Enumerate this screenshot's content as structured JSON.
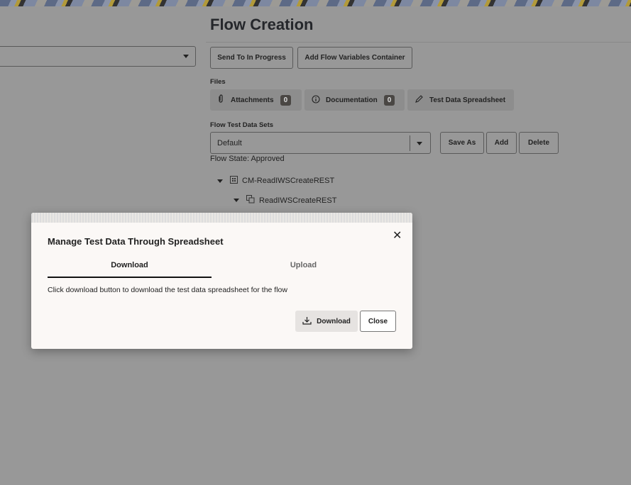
{
  "header": {
    "title": "Flow Creation"
  },
  "toolbar": {
    "send_label": "Send To In Progress",
    "add_container_label": "Add Flow Variables Container"
  },
  "files": {
    "label": "Files",
    "attachments": {
      "label": "Attachments",
      "count": "0"
    },
    "documentation": {
      "label": "Documentation",
      "count": "0"
    },
    "spreadsheet": {
      "label": "Test Data Spreadsheet"
    }
  },
  "datasets": {
    "label": "Flow Test Data Sets",
    "selected": "Default",
    "save_as": "Save As",
    "add": "Add",
    "delete": "Delete",
    "state": "Flow State: Approved"
  },
  "tree": [
    {
      "label": "CM-ReadIWSCreateREST",
      "icon": "grid-icon"
    },
    {
      "label": "ReadIWSCreateREST",
      "icon": "copy-icon"
    }
  ],
  "dialog": {
    "title": "Manage Test Data Through Spreadsheet",
    "tabs": [
      "Download",
      "Upload"
    ],
    "active_tab": "Download",
    "description": "Click download button to download the test data spreadsheet for the flow",
    "download_label": "Download",
    "close_label": "Close"
  }
}
